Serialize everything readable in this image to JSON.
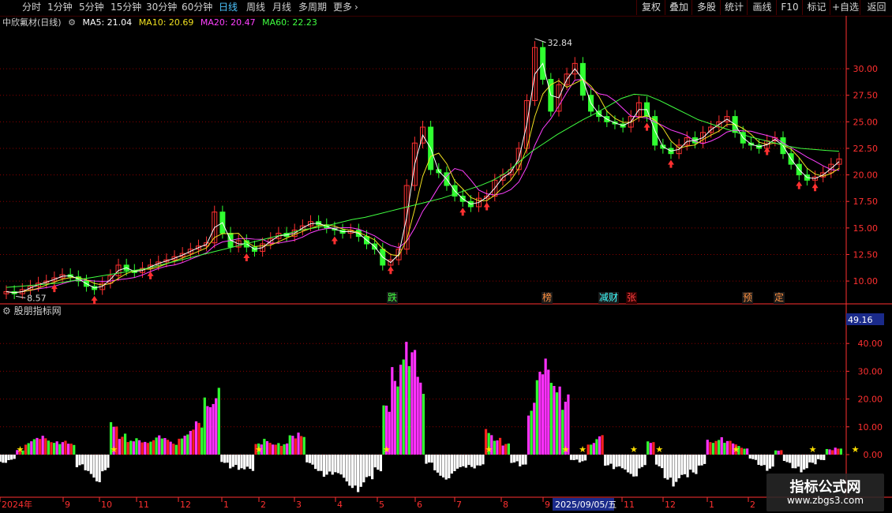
{
  "periods": [
    "分时",
    "1分钟",
    "5分钟",
    "15分钟",
    "30分钟",
    "60分钟",
    "日线",
    "周线",
    "月线",
    "多周期",
    "更多"
  ],
  "active_period": "日线",
  "tools": [
    "复权",
    "叠加",
    "多股",
    "统计",
    "画线",
    "F10",
    "标记",
    "+自选",
    "返回"
  ],
  "stock_title": "中欣氟材(日线)",
  "ma": [
    {
      "label": "MA5: 21.04",
      "color": "#ffffff"
    },
    {
      "label": "MA10: 20.69",
      "color": "#f0e020"
    },
    {
      "label": "MA20: 20.47",
      "color": "#ff40ff"
    },
    {
      "label": "MA60: 22.23",
      "color": "#40ff40"
    }
  ],
  "indicator_name": "股朋指标网",
  "indicator_value": "49.16",
  "price_axis": [
    "30.00",
    "27.50",
    "25.00",
    "22.50",
    "20.00",
    "17.50",
    "15.00",
    "12.50",
    "10.00"
  ],
  "ind_axis": [
    "40.00",
    "30.00",
    "20.00",
    "10.00",
    "0.00"
  ],
  "high_label": "32.84",
  "low_label": "8.57",
  "event_tags": [
    {
      "text": "跌",
      "color": "#40ff40"
    },
    {
      "text": "榜",
      "color": "#ff9040"
    },
    {
      "text": "减财",
      "color": "#40ffff"
    },
    {
      "text": "张",
      "color": "#ff4040"
    },
    {
      "text": "预",
      "color": "#ff9040"
    },
    {
      "text": "定",
      "color": "#ff9040"
    }
  ],
  "date_axis": [
    "2024年",
    "9",
    "10",
    "11",
    "12",
    "1",
    "2",
    "3",
    "4",
    "5",
    "6",
    "7",
    "8",
    "9",
    "2025/09/05/五",
    "11",
    "12",
    "1",
    "2"
  ],
  "watermark": {
    "title": "指标公式网",
    "url": "www.zbgs3.com"
  },
  "colors": {
    "up": "#ff3030",
    "down": "#30ff30",
    "grid": "#8a0000",
    "axis": "#ff3030",
    "bar_pink": "#ff30ff",
    "bar_green": "#30ff30",
    "bar_red": "#ff2020",
    "bar_white": "#ffffff"
  },
  "chart_data": {
    "type": "line",
    "title": "中欣氟材(日线)",
    "ylim": [
      8.0,
      33.5
    ],
    "high": 32.84,
    "low": 8.57,
    "close": [
      9.0,
      8.8,
      9.2,
      9.5,
      9.8,
      10.0,
      10.3,
      10.6,
      10.4,
      10.0,
      9.5,
      9.2,
      9.8,
      10.5,
      11.5,
      11.0,
      10.8,
      11.2,
      11.5,
      11.8,
      12.0,
      12.3,
      12.6,
      13.0,
      13.3,
      13.6,
      16.5,
      14.5,
      13.2,
      13.8,
      13.2,
      12.8,
      13.5,
      14.0,
      14.5,
      14.2,
      14.8,
      15.2,
      15.6,
      15.3,
      15.0,
      14.8,
      14.5,
      14.8,
      14.2,
      13.5,
      13.0,
      11.5,
      12.0,
      13.0,
      19.0,
      23.0,
      24.5,
      20.5,
      20.2,
      19.0,
      18.0,
      17.5,
      17.0,
      17.8,
      18.0,
      19.5,
      20.0,
      20.5,
      22.5,
      27.0,
      32.0,
      29.0,
      26.0,
      28.5,
      29.5,
      30.5,
      27.5,
      26.0,
      25.5,
      25.0,
      24.8,
      24.5,
      25.5,
      26.8,
      25.5,
      22.8,
      22.5,
      22.0,
      22.8,
      23.5,
      23.0,
      24.0,
      24.5,
      25.0,
      25.5,
      24.0,
      23.0,
      22.8,
      22.5,
      23.2,
      23.5,
      22.0,
      21.0,
      20.0,
      19.5,
      19.8,
      20.2,
      21.0,
      21.5
    ],
    "ma60": [
      9.4,
      9.5,
      9.6,
      9.7,
      9.8,
      10.0,
      10.2,
      10.4,
      10.6,
      10.8,
      11.0,
      11.2,
      11.5,
      11.8,
      12.1,
      12.4,
      12.7,
      13.0,
      13.3,
      13.6,
      13.9,
      14.2,
      14.5,
      14.8,
      15.0,
      15.2,
      15.5,
      15.8,
      16.0,
      16.3,
      16.6,
      16.9,
      17.2,
      17.5,
      17.8,
      18.2,
      18.6,
      19.0,
      19.5,
      20.2,
      21.2,
      22.2,
      23.0,
      23.8,
      24.5,
      25.2,
      25.8,
      26.5,
      27.2,
      27.6,
      27.5,
      27.0,
      26.4,
      25.8,
      25.2,
      24.8,
      24.4,
      24.0,
      23.6,
      23.3,
      23.0,
      22.7,
      22.5,
      22.4,
      22.3,
      22.23
    ],
    "indicator": [
      -3,
      -2,
      2,
      5,
      6,
      7,
      6,
      5,
      4,
      -5,
      -8,
      -10,
      -6,
      14,
      8,
      5,
      6,
      6,
      7,
      6,
      5,
      8,
      9,
      12,
      24,
      26,
      -3,
      -5,
      -7,
      -6,
      4,
      6,
      5,
      4,
      7,
      9,
      -4,
      -6,
      -8,
      -9,
      -10,
      -12,
      -14,
      -11,
      -6,
      18,
      35,
      46,
      38,
      28,
      -4,
      -8,
      -9,
      -7,
      -6,
      -5,
      -4,
      10,
      7,
      4,
      -3,
      -5,
      20,
      30,
      35,
      32,
      22,
      -2,
      -3,
      5,
      7,
      -4,
      -6,
      -7,
      -8,
      -5,
      6,
      -5,
      -9,
      -12,
      -10,
      -7,
      -4,
      6,
      7,
      5,
      4,
      3,
      -2,
      -4,
      -6,
      2,
      -3,
      -5,
      -7,
      -4,
      -2,
      2,
      3
    ]
  }
}
